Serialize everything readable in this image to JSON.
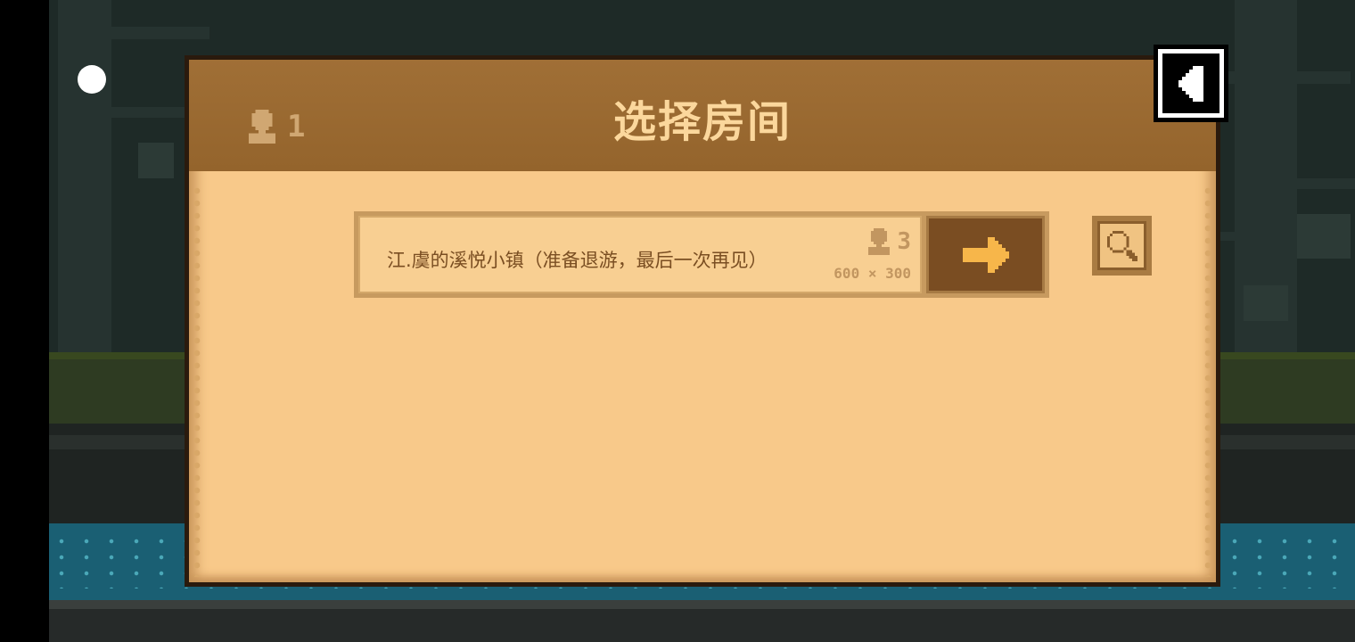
{
  "dialog": {
    "title": "选择房间",
    "online_players": "1"
  },
  "rooms": [
    {
      "name": "江.虞的溪悦小镇（准备退游，最后一次再见）",
      "players": "3",
      "size": "600 × 300"
    }
  ],
  "icons": {
    "players": "person-icon",
    "join": "arrow-right-icon",
    "search": "magnifier-icon",
    "back": "back-arrow-icon"
  },
  "colors": {
    "header": "#9a682f",
    "panel": "#f8c98a",
    "title": "#fbd79c",
    "arrow": "#f7b64a"
  }
}
